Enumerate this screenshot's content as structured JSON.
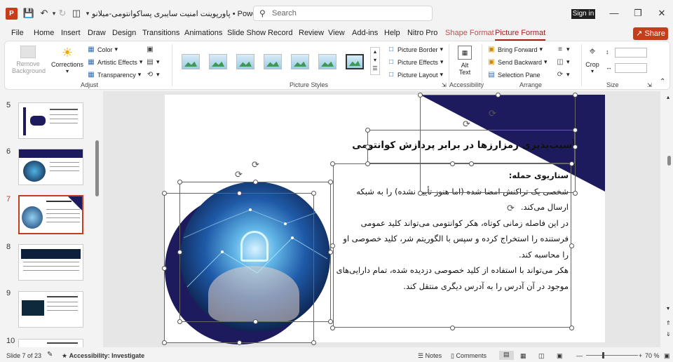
{
  "app": {
    "title": "پاورپوینت امنیت سایبری پساکوانتومی-میلانو  •  PowerP...",
    "search_placeholder": "Search",
    "signin": "Sign in",
    "share": "Share"
  },
  "menu": [
    "File",
    "Home",
    "Insert",
    "Draw",
    "Design",
    "Transitions",
    "Animations",
    "Slide Show",
    "Record",
    "Review",
    "View",
    "Add-ins",
    "Help",
    "Nitro Pro",
    "Shape Format",
    "Picture Format"
  ],
  "ribbon": {
    "adjust": {
      "remove_bg_1": "Remove",
      "remove_bg_2": "Background",
      "corrections": "Corrections",
      "color": "Color",
      "artistic": "Artistic Effects",
      "transparency": "Transparency",
      "label": "Adjust"
    },
    "styles": {
      "label": "Picture Styles",
      "border": "Picture Border",
      "effects": "Picture Effects",
      "layout": "Picture Layout"
    },
    "accessibility": {
      "alt1": "Alt",
      "alt2": "Text",
      "label": "Accessibility"
    },
    "arrange": {
      "forward": "Bring Forward",
      "backward": "Send Backward",
      "pane": "Selection Pane",
      "label": "Arrange"
    },
    "size": {
      "crop": "Crop",
      "label": "Size"
    }
  },
  "slides": [
    {
      "num": "5"
    },
    {
      "num": "6"
    },
    {
      "num": "7"
    },
    {
      "num": "8"
    },
    {
      "num": "9"
    },
    {
      "num": "10"
    }
  ],
  "slide": {
    "title": "آسیب‌پذیری رمزارزها در برابر پردازش کوانتومی",
    "heading": "سناریوی حمله:",
    "p1": "شخصی یک تراکنش امضا شده (اما هنوز تأیید نشده) را به شبکه ارسال می‌کند.",
    "p2": "در این فاصله زمانی کوتاه، هکر کوانتومی می‌تواند کلید عمومی فرستنده را استخراج کرده و سپس با الگوریتم شر، کلید خصوصی او را محاسبه کند.",
    "p3": "هکر می‌تواند با استفاده از کلید خصوصی دزدیده شده، تمام دارایی‌های موجود در آن آدرس را به آدرس دیگری منتقل کند."
  },
  "status": {
    "slide_of": "Slide 7 of 23",
    "accessibility": "Accessibility: Investigate",
    "notes": "Notes",
    "comments": "Comments",
    "zoom": "70 %"
  },
  "colors": {
    "accent": "#c43e1c",
    "navy": "#1d1b5e",
    "picture_tab": "#a61c1c"
  }
}
